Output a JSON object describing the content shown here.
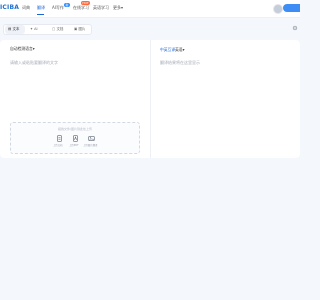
{
  "header": {
    "logo_text": "ICIBA",
    "nav": [
      {
        "label": "词典"
      },
      {
        "label": "翻译"
      },
      {
        "label": "AI写作"
      },
      {
        "label": "在线学习"
      },
      {
        "label": "英语学习"
      },
      {
        "label": "更多"
      }
    ],
    "ai_badge": "新",
    "learn_badge": "HOT"
  },
  "tabs": [
    {
      "label": "文本",
      "icon": "text-icon",
      "active": true
    },
    {
      "label": "AI",
      "icon": "ai-icon",
      "active": false
    },
    {
      "label": "文档",
      "icon": "document-icon",
      "active": false
    },
    {
      "label": "图片",
      "icon": "image-icon",
      "active": false
    }
  ],
  "source": {
    "language": "自动检测语言",
    "placeholder": "请输入或粘贴要翻译的文字"
  },
  "target": {
    "language_primary": "中英互译",
    "language_secondary": "英语",
    "placeholder": "翻译结果将在这里显示"
  },
  "upload": {
    "hint": "拖拽文件/图片到此处上传",
    "items": [
      {
        "label": "上传文档",
        "icon": "doc-upload-icon"
      },
      {
        "label": "上传PDF",
        "icon": "pdf-upload-icon"
      },
      {
        "label": "上传图片翻译",
        "icon": "image-upload-icon"
      }
    ]
  },
  "colors": {
    "accent": "#1a66d9",
    "background": "#f4f7fc",
    "card": "#ffffff"
  }
}
